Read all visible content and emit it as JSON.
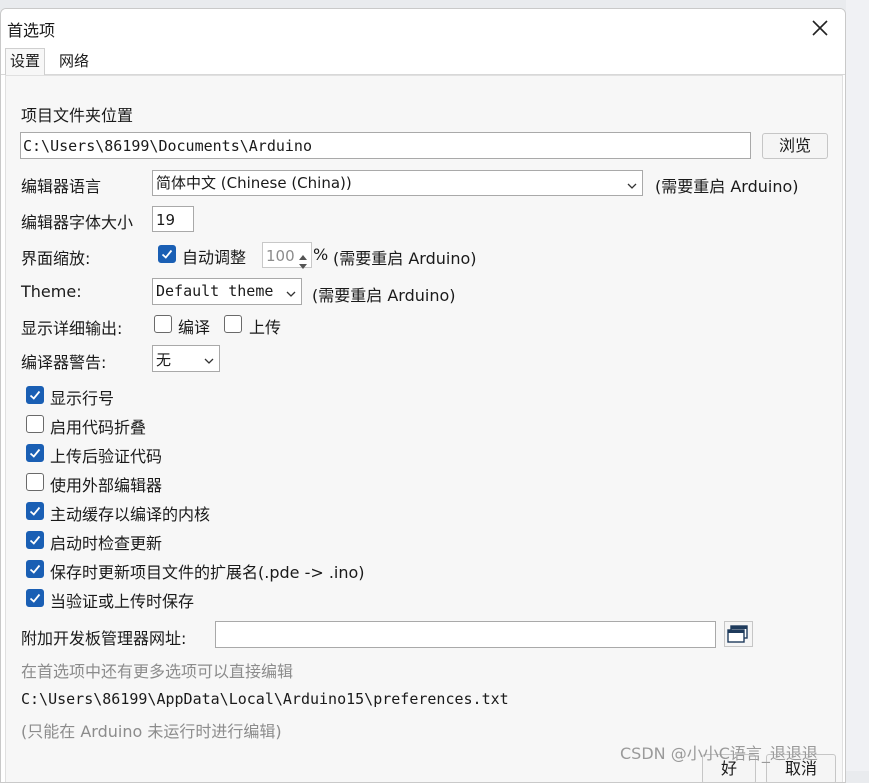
{
  "dialog": {
    "title": "首选项",
    "tabs": [
      {
        "label": "设置"
      },
      {
        "label": "网络"
      }
    ]
  },
  "settings": {
    "sketchbook_label": "项目文件夹位置",
    "sketchbook_path": "C:\\Users\\86199\\Documents\\Arduino",
    "browse_label": "浏览",
    "language_label": "编辑器语言",
    "language_value": "简体中文 (Chinese (China))",
    "restart_note": "(需要重启 Arduino)",
    "font_size_label": "编辑器字体大小",
    "font_size_value": "19",
    "scale_label": "界面缩放:",
    "auto_scale_label": "自动调整",
    "scale_value": "100",
    "percent": "%",
    "theme_label": "Theme:",
    "theme_value": "Default theme",
    "verbose_label": "显示详细输出:",
    "verbose_compile": "编译",
    "verbose_upload": "上传",
    "warnings_label": "编译器警告:",
    "warnings_value": "无",
    "options": [
      {
        "label": "显示行号",
        "checked": true
      },
      {
        "label": "启用代码折叠",
        "checked": false
      },
      {
        "label": "上传后验证代码",
        "checked": true
      },
      {
        "label": "使用外部编辑器",
        "checked": false
      },
      {
        "label": "主动缓存以编译的内核",
        "checked": true
      },
      {
        "label": "启动时检查更新",
        "checked": true
      },
      {
        "label": "保存时更新项目文件的扩展名(.pde -> .ino)",
        "checked": true
      },
      {
        "label": "当验证或上传时保存",
        "checked": true
      }
    ],
    "boards_url_label": "附加开发板管理器网址:",
    "boards_url_value": "",
    "more_prefs_note": "在首选项中还有更多选项可以直接编辑",
    "prefs_path": "C:\\Users\\86199\\AppData\\Local\\Arduino15\\preferences.txt",
    "edit_note": "(只能在 Arduino 未运行时进行编辑)"
  },
  "footer": {
    "ok_label": "好",
    "cancel_label": "取消"
  },
  "watermark": "CSDN @小小C语言_退退退",
  "colors": {
    "accent": "#1a5fb4",
    "muted": "#8c8c8c"
  },
  "icons": {
    "close": "close-icon",
    "dropdown": "chevron-down-icon",
    "url_editor": "window-stack-icon"
  }
}
